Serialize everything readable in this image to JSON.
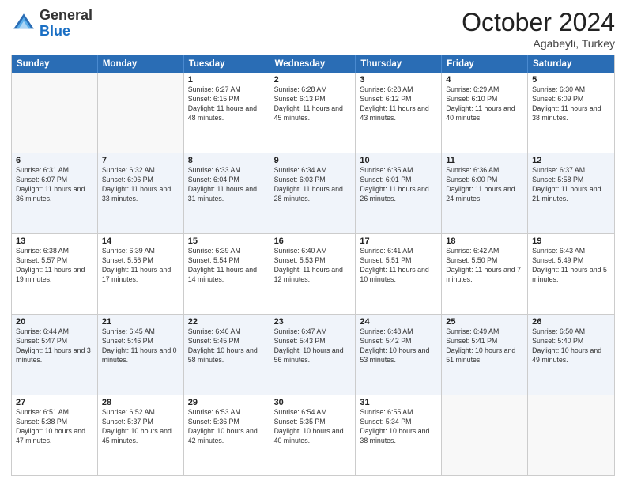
{
  "header": {
    "logo_general": "General",
    "logo_blue": "Blue",
    "month_title": "October 2024",
    "subtitle": "Agabeyli, Turkey"
  },
  "day_headers": [
    "Sunday",
    "Monday",
    "Tuesday",
    "Wednesday",
    "Thursday",
    "Friday",
    "Saturday"
  ],
  "weeks": [
    [
      {
        "day": "",
        "info": ""
      },
      {
        "day": "",
        "info": ""
      },
      {
        "day": "1",
        "info": "Sunrise: 6:27 AM\nSunset: 6:15 PM\nDaylight: 11 hours and 48 minutes."
      },
      {
        "day": "2",
        "info": "Sunrise: 6:28 AM\nSunset: 6:13 PM\nDaylight: 11 hours and 45 minutes."
      },
      {
        "day": "3",
        "info": "Sunrise: 6:28 AM\nSunset: 6:12 PM\nDaylight: 11 hours and 43 minutes."
      },
      {
        "day": "4",
        "info": "Sunrise: 6:29 AM\nSunset: 6:10 PM\nDaylight: 11 hours and 40 minutes."
      },
      {
        "day": "5",
        "info": "Sunrise: 6:30 AM\nSunset: 6:09 PM\nDaylight: 11 hours and 38 minutes."
      }
    ],
    [
      {
        "day": "6",
        "info": "Sunrise: 6:31 AM\nSunset: 6:07 PM\nDaylight: 11 hours and 36 minutes."
      },
      {
        "day": "7",
        "info": "Sunrise: 6:32 AM\nSunset: 6:06 PM\nDaylight: 11 hours and 33 minutes."
      },
      {
        "day": "8",
        "info": "Sunrise: 6:33 AM\nSunset: 6:04 PM\nDaylight: 11 hours and 31 minutes."
      },
      {
        "day": "9",
        "info": "Sunrise: 6:34 AM\nSunset: 6:03 PM\nDaylight: 11 hours and 28 minutes."
      },
      {
        "day": "10",
        "info": "Sunrise: 6:35 AM\nSunset: 6:01 PM\nDaylight: 11 hours and 26 minutes."
      },
      {
        "day": "11",
        "info": "Sunrise: 6:36 AM\nSunset: 6:00 PM\nDaylight: 11 hours and 24 minutes."
      },
      {
        "day": "12",
        "info": "Sunrise: 6:37 AM\nSunset: 5:58 PM\nDaylight: 11 hours and 21 minutes."
      }
    ],
    [
      {
        "day": "13",
        "info": "Sunrise: 6:38 AM\nSunset: 5:57 PM\nDaylight: 11 hours and 19 minutes."
      },
      {
        "day": "14",
        "info": "Sunrise: 6:39 AM\nSunset: 5:56 PM\nDaylight: 11 hours and 17 minutes."
      },
      {
        "day": "15",
        "info": "Sunrise: 6:39 AM\nSunset: 5:54 PM\nDaylight: 11 hours and 14 minutes."
      },
      {
        "day": "16",
        "info": "Sunrise: 6:40 AM\nSunset: 5:53 PM\nDaylight: 11 hours and 12 minutes."
      },
      {
        "day": "17",
        "info": "Sunrise: 6:41 AM\nSunset: 5:51 PM\nDaylight: 11 hours and 10 minutes."
      },
      {
        "day": "18",
        "info": "Sunrise: 6:42 AM\nSunset: 5:50 PM\nDaylight: 11 hours and 7 minutes."
      },
      {
        "day": "19",
        "info": "Sunrise: 6:43 AM\nSunset: 5:49 PM\nDaylight: 11 hours and 5 minutes."
      }
    ],
    [
      {
        "day": "20",
        "info": "Sunrise: 6:44 AM\nSunset: 5:47 PM\nDaylight: 11 hours and 3 minutes."
      },
      {
        "day": "21",
        "info": "Sunrise: 6:45 AM\nSunset: 5:46 PM\nDaylight: 11 hours and 0 minutes."
      },
      {
        "day": "22",
        "info": "Sunrise: 6:46 AM\nSunset: 5:45 PM\nDaylight: 10 hours and 58 minutes."
      },
      {
        "day": "23",
        "info": "Sunrise: 6:47 AM\nSunset: 5:43 PM\nDaylight: 10 hours and 56 minutes."
      },
      {
        "day": "24",
        "info": "Sunrise: 6:48 AM\nSunset: 5:42 PM\nDaylight: 10 hours and 53 minutes."
      },
      {
        "day": "25",
        "info": "Sunrise: 6:49 AM\nSunset: 5:41 PM\nDaylight: 10 hours and 51 minutes."
      },
      {
        "day": "26",
        "info": "Sunrise: 6:50 AM\nSunset: 5:40 PM\nDaylight: 10 hours and 49 minutes."
      }
    ],
    [
      {
        "day": "27",
        "info": "Sunrise: 6:51 AM\nSunset: 5:38 PM\nDaylight: 10 hours and 47 minutes."
      },
      {
        "day": "28",
        "info": "Sunrise: 6:52 AM\nSunset: 5:37 PM\nDaylight: 10 hours and 45 minutes."
      },
      {
        "day": "29",
        "info": "Sunrise: 6:53 AM\nSunset: 5:36 PM\nDaylight: 10 hours and 42 minutes."
      },
      {
        "day": "30",
        "info": "Sunrise: 6:54 AM\nSunset: 5:35 PM\nDaylight: 10 hours and 40 minutes."
      },
      {
        "day": "31",
        "info": "Sunrise: 6:55 AM\nSunset: 5:34 PM\nDaylight: 10 hours and 38 minutes."
      },
      {
        "day": "",
        "info": ""
      },
      {
        "day": "",
        "info": ""
      }
    ]
  ]
}
